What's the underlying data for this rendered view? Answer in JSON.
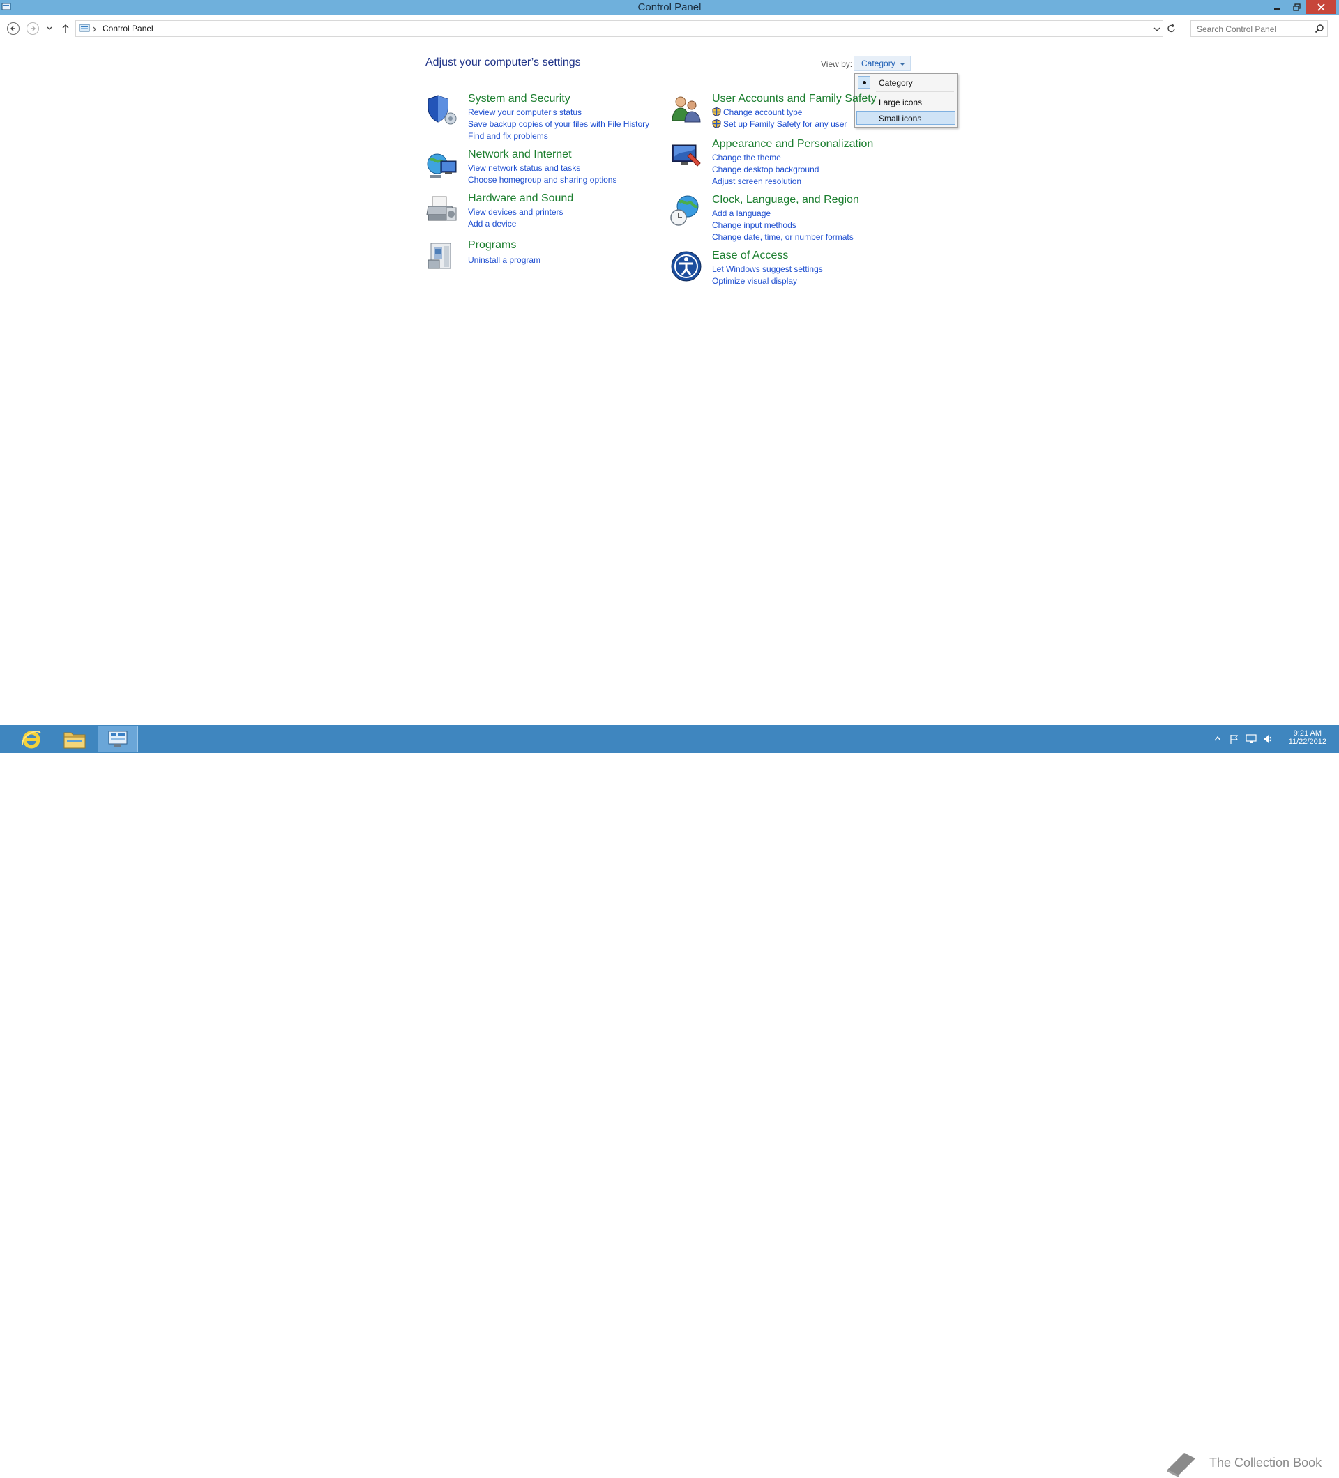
{
  "window": {
    "title": "Control Panel"
  },
  "address": {
    "crumb": "Control Panel",
    "search_placeholder": "Search Control Panel"
  },
  "content": {
    "title": "Adjust your computer’s settings",
    "view_by_label": "View by:",
    "view_by_value": "Category",
    "menu": [
      "Category",
      "Large icons",
      "Small icons"
    ]
  },
  "categories": {
    "system": {
      "head": "System and Security",
      "links": [
        "Review your computer's status",
        "Save backup copies of your files with File History",
        "Find and fix problems"
      ]
    },
    "network": {
      "head": "Network and Internet",
      "links": [
        "View network status and tasks",
        "Choose homegroup and sharing options"
      ]
    },
    "hardware": {
      "head": "Hardware and Sound",
      "links": [
        "View devices and printers",
        "Add a device"
      ]
    },
    "programs": {
      "head": "Programs",
      "links": [
        "Uninstall a program"
      ]
    },
    "users": {
      "head": "User Accounts and Family Safety",
      "links": [
        "Change account type",
        "Set up Family Safety for any user"
      ]
    },
    "appearance": {
      "head": "Appearance and Personalization",
      "links": [
        "Change the theme",
        "Change desktop background",
        "Adjust screen resolution"
      ]
    },
    "clock": {
      "head": "Clock, Language, and Region",
      "links": [
        "Add a language",
        "Change input methods",
        "Change date, time, or number formats"
      ]
    },
    "ease": {
      "head": "Ease of Access",
      "links": [
        "Let Windows suggest settings",
        "Optimize visual display"
      ]
    }
  },
  "taskbar": {
    "time": "9:21 AM",
    "date": "11/22/2012",
    "watermark": "The Collection Book"
  },
  "colors": {
    "accent": "#6fb0dc",
    "taskbar": "#3f86bf",
    "link": "#1f4fd0",
    "heading": "#1b7e2e"
  }
}
